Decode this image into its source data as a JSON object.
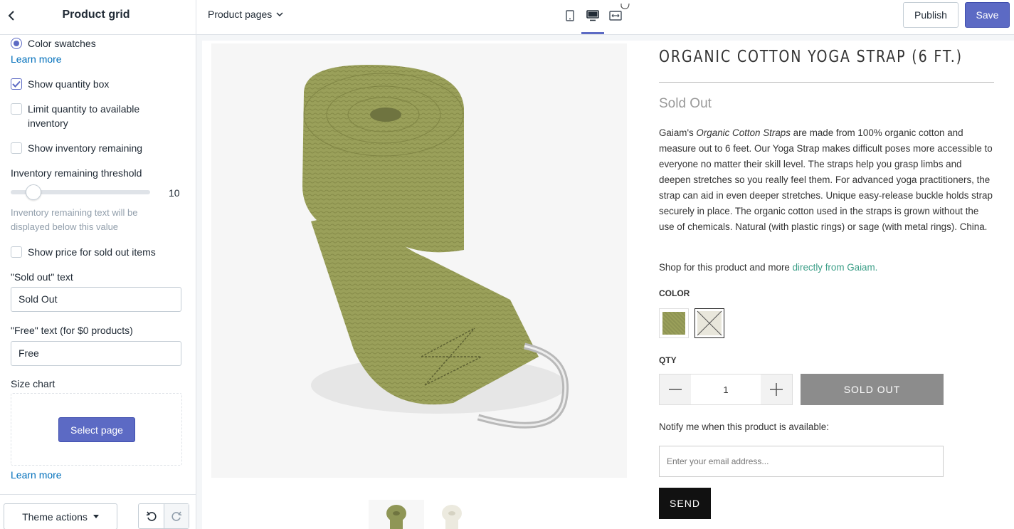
{
  "sidebar": {
    "title": "Product grid",
    "color_swatches_label": "Color swatches",
    "learn_more_1": "Learn more",
    "show_quantity_box": "Show quantity box",
    "limit_quantity_line1": "Limit quantity to available",
    "limit_quantity_line2": "inventory",
    "show_inventory_remaining": "Show inventory remaining",
    "inventory_threshold_label": "Inventory remaining threshold",
    "inventory_threshold_value": "10",
    "threshold_fraction": 0.1,
    "inventory_help_line1": "Inventory remaining text will be",
    "inventory_help_line2": "displayed below this value",
    "show_price_sold_out": "Show price for sold out items",
    "sold_out_text_label": "\"Sold out\" text",
    "sold_out_text_value": "Sold Out",
    "free_text_label": "\"Free\" text (for $0 products)",
    "free_text_value": "Free",
    "size_chart_label": "Size chart",
    "select_page_button": "Select page",
    "learn_more_2": "Learn more",
    "checkbox_states": {
      "color_swatches": true,
      "show_quantity_box": true,
      "limit_quantity": false,
      "show_inventory_remaining": false,
      "show_price_sold_out": false
    }
  },
  "footer": {
    "theme_actions": "Theme actions"
  },
  "topbar": {
    "page_selector": "Product pages",
    "publish": "Publish",
    "save": "Save",
    "accent": "#5c6ac4"
  },
  "product": {
    "title": "ORGANIC COTTON YOGA STRAP (6 FT.)",
    "status": "Sold Out",
    "desc_prefix": "Gaiam's ",
    "desc_italic": "Organic Cotton Straps",
    "desc_rest": " are made from 100% organic cotton and measure out to 6 feet. Our Yoga Strap makes difficult poses more accessible to everyone no matter their skill level. The straps help you grasp limbs and deepen stretches so you really feel them. For advanced yoga practitioners, the strap can aid in even deeper stretches. Unique easy-release buckle holds strap securely in place. The organic cotton used in the straps is grown without the use of chemicals. Natural (with plastic rings) or sage (with metal rings). China.",
    "shop_prefix": "Shop for this product and more ",
    "shop_link": "directly from Gaiam.",
    "color_label": "COLOR",
    "qty_label": "QTY",
    "qty_value": "1",
    "sold_out_button": "SOLD OUT",
    "notify_text": "Notify me when this product is available:",
    "email_placeholder": "Enter your email address...",
    "send_button": "SEND",
    "link_color": "#3b9e87",
    "strap_color": "#9aa05a"
  }
}
